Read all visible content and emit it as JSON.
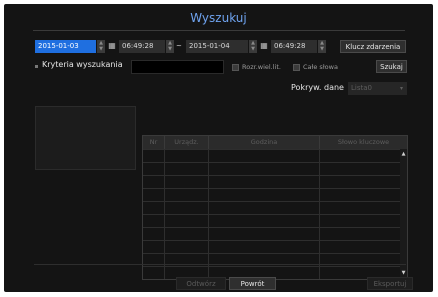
{
  "title": "Wyszukuj",
  "date_from": "2015-01-03",
  "time_from": "06:49:28",
  "separator": "~",
  "date_to": "2015-01-04",
  "time_to": "06:49:28",
  "event_key_button": "Klucz zdarzenia",
  "criteria_label": "Kryteria wyszukania",
  "criteria_value": "",
  "case_sensitive_label": "Rozr.wiel.lit.",
  "whole_word_label": "Całe słowa",
  "search_button": "Szukaj",
  "overlap_label": "Pokryw. dane",
  "overlap_value": "Lista0",
  "table": {
    "columns": [
      "Nr",
      "Urządz.",
      "Godzina",
      "Słowo kluczowe"
    ],
    "rows": [
      "",
      "",
      "",
      "",
      "",
      "",
      "",
      "",
      "",
      ""
    ]
  },
  "buttons": {
    "play": "Odtwórz",
    "back": "Powrót",
    "export": "Eksportuj"
  },
  "colors": {
    "accent": "#1f6fe0",
    "title": "#6fa3ef",
    "background": "#141414"
  }
}
